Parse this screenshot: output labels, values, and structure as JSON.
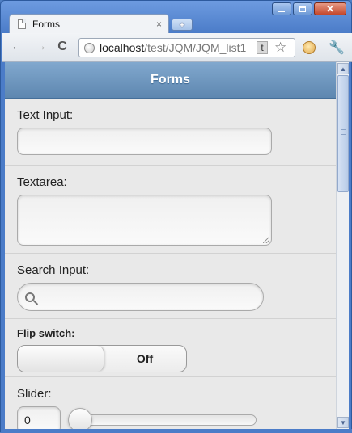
{
  "window": {
    "minimize_icon": "minimize-icon",
    "maximize_icon": "maximize-icon",
    "close_glyph": "✕"
  },
  "tab": {
    "title": "Forms",
    "close_glyph": "×",
    "new_tab_glyph": "+"
  },
  "toolbar": {
    "back_glyph": "←",
    "forward_glyph": "→",
    "reload_glyph": "C",
    "url_host": "localhost",
    "url_path": "/test/JQM/JQM_list1",
    "t_badge": "t",
    "star_glyph": "☆",
    "wrench_glyph": "🔧"
  },
  "page": {
    "header_title": "Forms",
    "text_input_label": "Text Input:",
    "textarea_label": "Textarea:",
    "search_input_label": "Search Input:",
    "flip_switch_label": "Flip switch:",
    "flip_switch_state": "Off",
    "slider_label": "Slider:",
    "slider_value": "0"
  },
  "scrollbar": {
    "up_glyph": "▲",
    "down_glyph": "▼"
  },
  "colors": {
    "header_bar": "#6f97bf",
    "page_background": "#e9e9e9",
    "window_chrome": "#4b7cc8"
  }
}
